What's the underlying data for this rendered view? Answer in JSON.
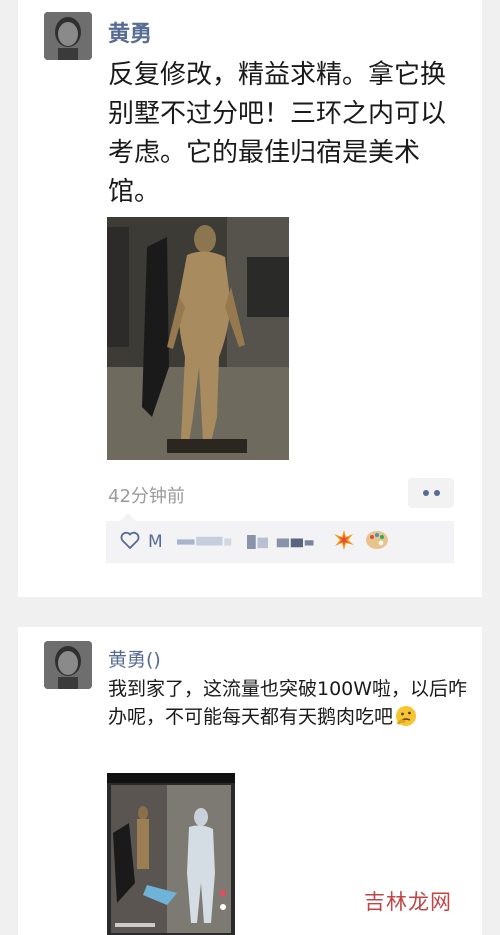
{
  "posts": [
    {
      "author": "黄勇",
      "text": "反复修改，精益求精。拿它换别墅不过分吧！三环之内可以考虑。它的最佳归宿是美术馆。",
      "time": "42分钟前",
      "likes_prefix": "M"
    },
    {
      "author": "黄勇()",
      "text": "我到家了，这流量也突破100W啦，以后咋办呢，不可能每天都有天鹅肉吃吧"
    }
  ],
  "watermark": "吉林龙网",
  "icons": {
    "more": "more-dots-icon",
    "like": "heart-icon",
    "emoji1": "collision-emoji-icon",
    "emoji2": "palette-emoji-icon",
    "emoji3": "thinking-emoji-icon"
  }
}
